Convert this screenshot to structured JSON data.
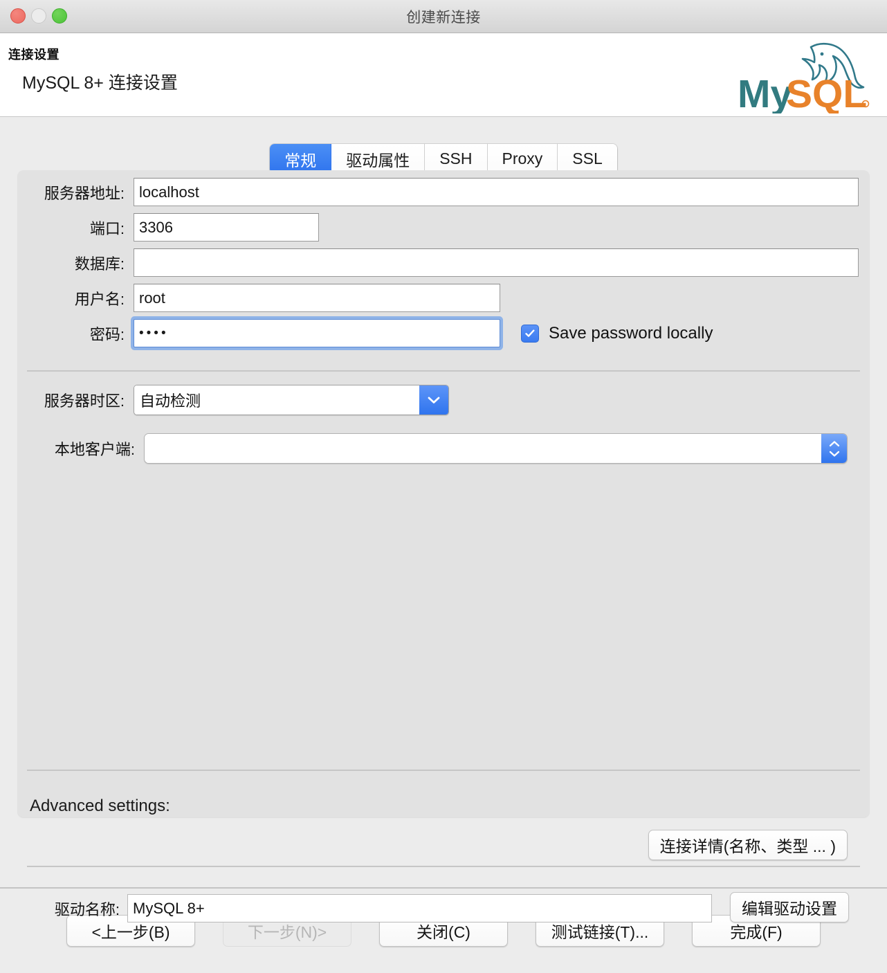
{
  "window": {
    "title": "创建新连接",
    "traffic_lights": [
      "close",
      "minimize",
      "maximize"
    ]
  },
  "header": {
    "title": "连接设置",
    "subtitle": "MySQL 8+ 连接设置",
    "logo_text_primary": "My",
    "logo_text_secondary": "SQL",
    "logo_colors": {
      "dolphin": "#31798a",
      "my": "#327b80",
      "sql": "#e8822a"
    }
  },
  "tabs": [
    {
      "label": "常规",
      "active": true
    },
    {
      "label": "驱动属性",
      "active": false
    },
    {
      "label": "SSH",
      "active": false
    },
    {
      "label": "Proxy",
      "active": false
    },
    {
      "label": "SSL",
      "active": false
    }
  ],
  "form": {
    "host": {
      "label": "服务器地址:",
      "value": "localhost",
      "placeholder": ""
    },
    "port": {
      "label": "端口:",
      "value": "3306",
      "placeholder": ""
    },
    "database": {
      "label": "数据库:",
      "value": "",
      "placeholder": ""
    },
    "username": {
      "label": "用户名:",
      "value": "root",
      "placeholder": ""
    },
    "password": {
      "label": "密码:",
      "value": "••••",
      "placeholder": "",
      "focused": true
    },
    "save_password": {
      "label": "Save password locally",
      "checked": true
    },
    "server_timezone": {
      "label": "服务器时区:",
      "value": "自动检测"
    },
    "local_client": {
      "label": "本地客户端:",
      "value": ""
    }
  },
  "advanced": {
    "label": "Advanced settings:",
    "connection_details_button": "连接详情(名称、类型 ... )"
  },
  "driver": {
    "label": "驱动名称:",
    "value": "MySQL 8+",
    "edit_button": "编辑驱动设置"
  },
  "footer": {
    "buttons": [
      {
        "label": "<上一步(B)",
        "disabled": false
      },
      {
        "label": "下一步(N)>",
        "disabled": true
      },
      {
        "label": "关闭(C)",
        "disabled": false
      },
      {
        "label": "测试链接(T)...",
        "disabled": false
      },
      {
        "label": "完成(F)",
        "disabled": false
      }
    ]
  },
  "colors": {
    "accent": "#2f74ee",
    "window_bg": "#ececec",
    "panel_bg": "#e2e2e2",
    "focus_ring": "#8fb3e8"
  }
}
